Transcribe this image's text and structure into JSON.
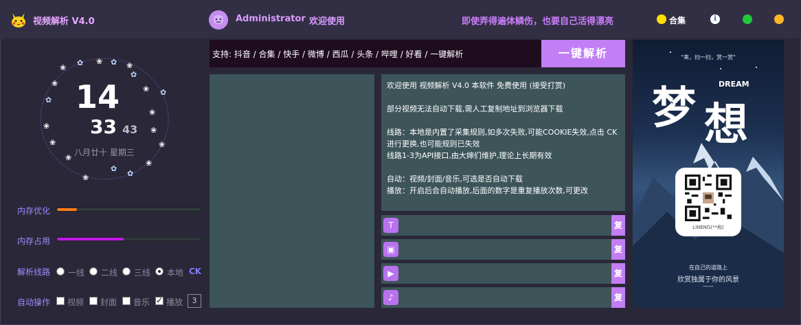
{
  "header": {
    "app_title": "视频解析 V4.0",
    "user_name": "Administrator",
    "user_welcome": "欢迎使用",
    "slogan": "即使弄得遍体鳞伤，也要自己活得漂亮",
    "collection_label": "合集",
    "info_glyph": "i",
    "colors": {
      "collection_dot": "#ffe100",
      "green_dot": "#22c93a",
      "orange_dot": "#ffb42a",
      "accent": "#c17ef5"
    }
  },
  "clock": {
    "hour": "14",
    "minute": "33",
    "second": "43",
    "date": "八月廿十 星期三"
  },
  "controls": {
    "memory_optimize_label": "内存优化",
    "memory_optimize_level": 0.14,
    "memory_usage_label": "内存占用",
    "memory_usage_level": 0.46,
    "route_label": "解析线路",
    "routes": [
      {
        "label": "一线",
        "selected": false
      },
      {
        "label": "二线",
        "selected": false
      },
      {
        "label": "三线",
        "selected": false
      },
      {
        "label": "本地",
        "selected": true
      }
    ],
    "ck_label": "CK",
    "auto_label": "自动操作",
    "auto_options": [
      {
        "label": "视频",
        "checked": false
      },
      {
        "label": "封面",
        "checked": false
      },
      {
        "label": "音乐",
        "checked": false
      },
      {
        "label": "播放",
        "checked": true
      }
    ],
    "play_count": "3"
  },
  "url_bar": {
    "text": "支持: 抖音 / 合集 / 快手 / 微博 / 西瓜 / 头条 / 哔哩 / 好看 / 一键解析",
    "parse_button": "一键解析"
  },
  "notes": {
    "line1": "欢迎使用 视频解析 V4.0 本软件 免费使用 (接受打赏)",
    "line2": "部分视频无法自动下载,需人工复制地址到浏览器下载",
    "line3": "线路：本地是内置了采集规则,如多次失败,可能COOKIE失效,点击 CK 进行更换,也可能规则已失效",
    "line4": "线路1-3为API接口,由大婶们维护,理论上长期有效",
    "line5": "自动：视频/封面/音乐,可选是否自动下载",
    "line6": "播放：开启后会自动播放,后面的数字是重复播放次数,可更改"
  },
  "results": {
    "copy_label": "复",
    "rows": [
      {
        "icon": "text-icon",
        "glyph": "T"
      },
      {
        "icon": "image-icon",
        "glyph": "▣"
      },
      {
        "icon": "video-icon",
        "glyph": "▶"
      },
      {
        "icon": "music-icon",
        "glyph": "♪"
      }
    ]
  },
  "poster": {
    "quote": "\"来，扫一扫，赏一赏\"",
    "dream_cn_1": "梦",
    "dream_cn_2": "想",
    "dream_en": "DREAM",
    "qr_name": "LiNENG(**和)",
    "line1": "在自己的道路上",
    "line2": "欣赏独属于你的风景",
    "dash": "——"
  }
}
